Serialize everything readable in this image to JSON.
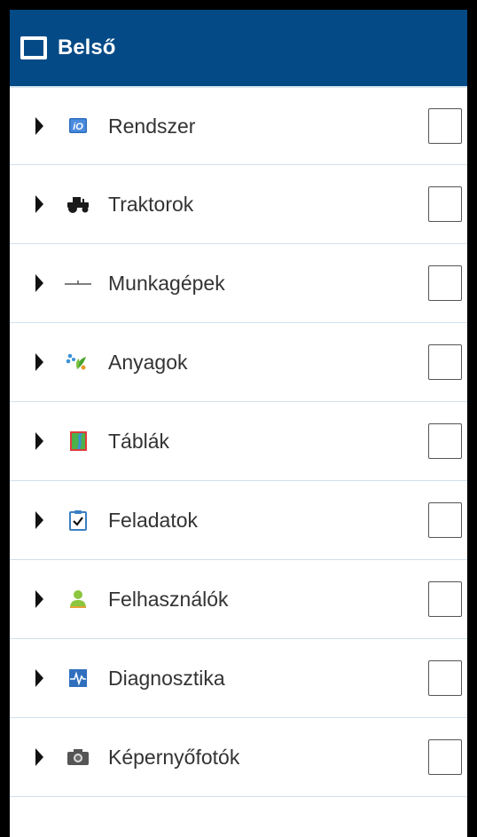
{
  "header": {
    "title": "Belső"
  },
  "items": [
    {
      "label": "Rendszer",
      "icon": "isobus-io-icon",
      "checked": false
    },
    {
      "label": "Traktorok",
      "icon": "tractor-icon",
      "checked": false
    },
    {
      "label": "Munkagépek",
      "icon": "implement-icon",
      "checked": false
    },
    {
      "label": "Anyagok",
      "icon": "materials-icon",
      "checked": false
    },
    {
      "label": "Táblák",
      "icon": "field-icon",
      "checked": false
    },
    {
      "label": "Feladatok",
      "icon": "tasks-clipboard-icon",
      "checked": false
    },
    {
      "label": "Felhasználók",
      "icon": "user-icon",
      "checked": false
    },
    {
      "label": "Diagnosztika",
      "icon": "diagnostics-pulse-icon",
      "checked": false
    },
    {
      "label": "Képernyőfotók",
      "icon": "camera-icon",
      "checked": false
    }
  ],
  "colors": {
    "header_background": "#044a86",
    "header_text": "#ffffff",
    "row_divider": "#cfe0ec",
    "label_text": "#333333"
  }
}
